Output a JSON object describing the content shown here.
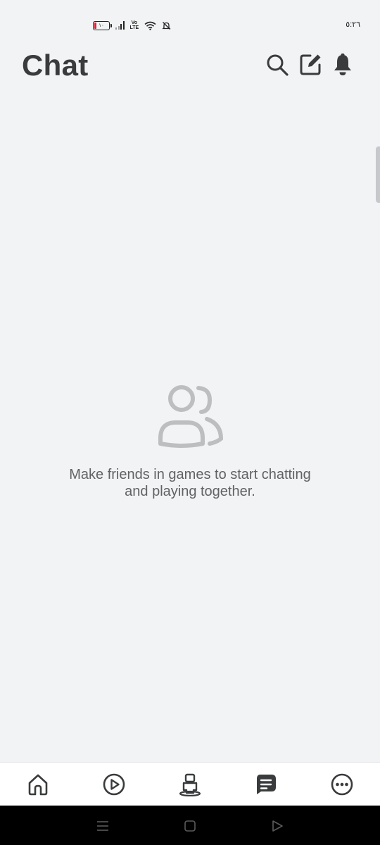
{
  "status_bar": {
    "time": "٥:٢٦",
    "battery_level": "١٠",
    "network": "VoLTE",
    "icons": [
      "battery-icon",
      "signal-icon",
      "volte-icon",
      "wifi-icon",
      "mute-icon"
    ]
  },
  "header": {
    "title": "Chat",
    "actions": [
      "search-icon",
      "compose-icon",
      "bell-icon"
    ]
  },
  "empty_state": {
    "icon": "friends-icon",
    "message_line1": "Make friends in games to start chatting",
    "message_line2": "and playing together."
  },
  "bottom_nav": {
    "items": [
      {
        "name": "home",
        "icon": "home-icon",
        "active": false
      },
      {
        "name": "play",
        "icon": "play-icon",
        "active": false
      },
      {
        "name": "avatar",
        "icon": "avatar-icon",
        "active": false
      },
      {
        "name": "chat",
        "icon": "chat-icon",
        "active": true
      },
      {
        "name": "more",
        "icon": "more-icon",
        "active": false
      }
    ]
  },
  "system_nav": [
    "menu-icon",
    "home-square-icon",
    "back-icon"
  ],
  "colors": {
    "background": "#f2f3f5",
    "title": "#393b3d",
    "icon": "#393b3d",
    "muted_icon": "#bdbec0",
    "message_text": "#606264",
    "nav_background": "#ffffff",
    "system_bar": "#000000"
  }
}
